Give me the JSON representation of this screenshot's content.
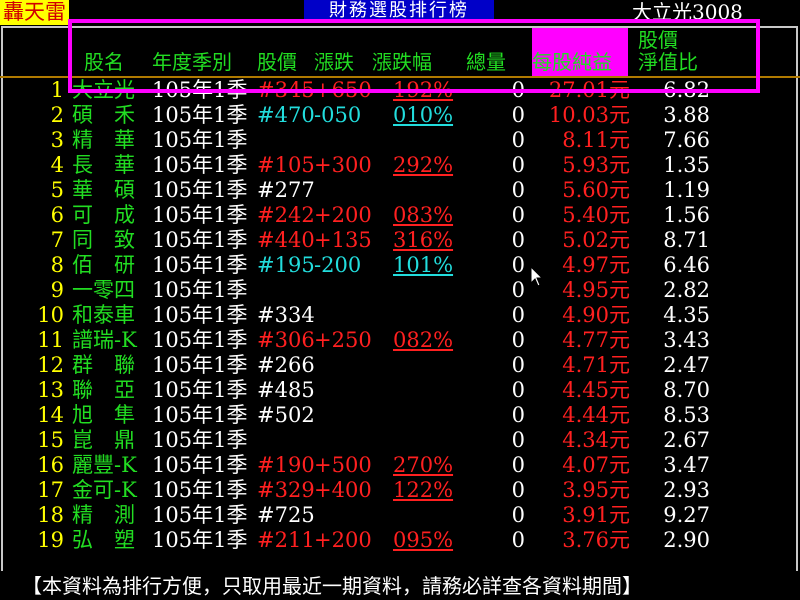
{
  "topbar": {
    "brand": "轟天雷",
    "board_title": "財務選股排行榜",
    "stock_title": "大立光3008"
  },
  "headers": {
    "name": "股名",
    "period": "年度季別",
    "price": "股價",
    "change": "漲跌",
    "change_pct": "漲跌幅",
    "volume": "總量",
    "eps": "每股純益",
    "pb_line1": "股價",
    "pb_line2": "淨值比"
  },
  "colors": {
    "header_green": "#22dd22",
    "eps_header_bg": "#ff00ff",
    "highlight_border": "#ff00ff",
    "up_red": "#ff2020",
    "down_cyan": "#22dddd",
    "index_yellow": "#ffff00"
  },
  "rows": [
    {
      "rank": "1",
      "name": "大立光",
      "period": "105年1季",
      "price": "#345",
      "change": "+650",
      "pct": "192%",
      "volume": "0",
      "eps": "27.01元",
      "pb": "6.82",
      "dir": "up"
    },
    {
      "rank": "2",
      "name": "碩　禾",
      "period": "105年1季",
      "price": "#470",
      "change": "-050",
      "pct": "010%",
      "volume": "0",
      "eps": "10.03元",
      "pb": "3.88",
      "dir": "down"
    },
    {
      "rank": "3",
      "name": "精　華",
      "period": "105年1季",
      "price": "",
      "change": "",
      "pct": "",
      "volume": "0",
      "eps": "8.11元",
      "pb": "7.66",
      "dir": "none"
    },
    {
      "rank": "4",
      "name": "長　華",
      "period": "105年1季",
      "price": "#105",
      "change": "+300",
      "pct": "292%",
      "volume": "0",
      "eps": "5.93元",
      "pb": "1.35",
      "dir": "up"
    },
    {
      "rank": "5",
      "name": "華　碩",
      "period": "105年1季",
      "price": "#277",
      "change": "",
      "pct": "",
      "volume": "0",
      "eps": "5.60元",
      "pb": "1.19",
      "dir": "flat"
    },
    {
      "rank": "6",
      "name": "可　成",
      "period": "105年1季",
      "price": "#242",
      "change": "+200",
      "pct": "083%",
      "volume": "0",
      "eps": "5.40元",
      "pb": "1.56",
      "dir": "up"
    },
    {
      "rank": "7",
      "name": "同　致",
      "period": "105年1季",
      "price": "#440",
      "change": "+135",
      "pct": "316%",
      "volume": "0",
      "eps": "5.02元",
      "pb": "8.71",
      "dir": "up"
    },
    {
      "rank": "8",
      "name": "佰　研",
      "period": "105年1季",
      "price": "#195",
      "change": "-200",
      "pct": "101%",
      "volume": "0",
      "eps": "4.97元",
      "pb": "6.46",
      "dir": "down"
    },
    {
      "rank": "9",
      "name": "一零四",
      "period": "105年1季",
      "price": "",
      "change": "",
      "pct": "",
      "volume": "0",
      "eps": "4.95元",
      "pb": "2.82",
      "dir": "none"
    },
    {
      "rank": "10",
      "name": "和泰車",
      "period": "105年1季",
      "price": "#334",
      "change": "",
      "pct": "",
      "volume": "0",
      "eps": "4.90元",
      "pb": "4.35",
      "dir": "flat"
    },
    {
      "rank": "11",
      "name": "譜瑞-K",
      "period": "105年1季",
      "price": "#306",
      "change": "+250",
      "pct": "082%",
      "volume": "0",
      "eps": "4.77元",
      "pb": "3.43",
      "dir": "up"
    },
    {
      "rank": "12",
      "name": "群　聯",
      "period": "105年1季",
      "price": "#266",
      "change": "",
      "pct": "",
      "volume": "0",
      "eps": "4.71元",
      "pb": "2.47",
      "dir": "flat"
    },
    {
      "rank": "13",
      "name": "聯　亞",
      "period": "105年1季",
      "price": "#485",
      "change": "",
      "pct": "",
      "volume": "0",
      "eps": "4.45元",
      "pb": "8.70",
      "dir": "flat"
    },
    {
      "rank": "14",
      "name": "旭　隼",
      "period": "105年1季",
      "price": "#502",
      "change": "",
      "pct": "",
      "volume": "0",
      "eps": "4.44元",
      "pb": "8.53",
      "dir": "flat"
    },
    {
      "rank": "15",
      "name": "崑　鼎",
      "period": "105年1季",
      "price": "",
      "change": "",
      "pct": "",
      "volume": "0",
      "eps": "4.34元",
      "pb": "2.67",
      "dir": "none"
    },
    {
      "rank": "16",
      "name": "麗豐-K",
      "period": "105年1季",
      "price": "#190",
      "change": "+500",
      "pct": "270%",
      "volume": "0",
      "eps": "4.07元",
      "pb": "3.47",
      "dir": "up"
    },
    {
      "rank": "17",
      "name": "金可-K",
      "period": "105年1季",
      "price": "#329",
      "change": "+400",
      "pct": "122%",
      "volume": "0",
      "eps": "3.95元",
      "pb": "2.93",
      "dir": "up"
    },
    {
      "rank": "18",
      "name": "精　測",
      "period": "105年1季",
      "price": "#725",
      "change": "",
      "pct": "",
      "volume": "0",
      "eps": "3.91元",
      "pb": "9.27",
      "dir": "flat"
    },
    {
      "rank": "19",
      "name": "弘　塑",
      "period": "105年1季",
      "price": "#211",
      "change": "+200",
      "pct": "095%",
      "volume": "0",
      "eps": "3.76元",
      "pb": "2.90",
      "dir": "up"
    }
  ],
  "footer": "【本資料為排行方便，只取用最近一期資料，請務必詳查各資料期間】"
}
